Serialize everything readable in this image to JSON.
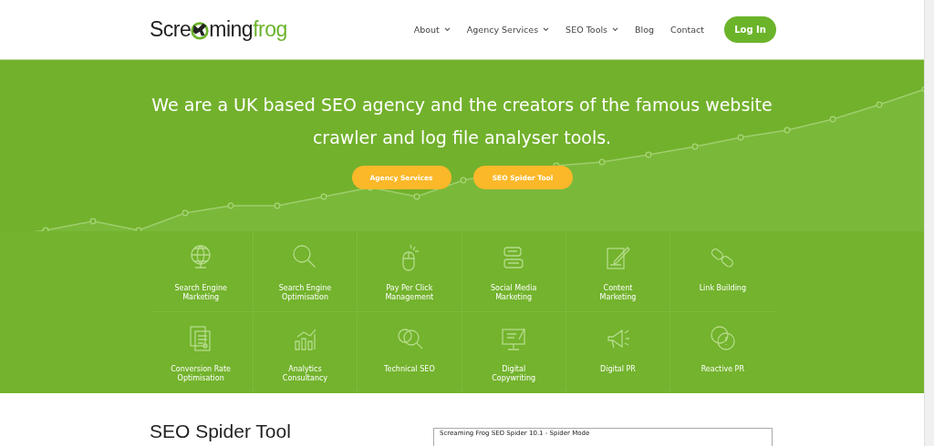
{
  "logo": {
    "part_1": "Scre",
    "part_2": "ming",
    "part_3": "frog"
  },
  "nav": [
    {
      "label": "About",
      "dropdown": true
    },
    {
      "label": "Agency Services",
      "dropdown": true
    },
    {
      "label": "SEO Tools",
      "dropdown": true
    },
    {
      "label": "Blog",
      "dropdown": false
    },
    {
      "label": "Contact",
      "dropdown": false
    }
  ],
  "login_button": "Log In",
  "hero": {
    "headline": "We are a UK based SEO agency and the creators of the famous website crawler and log file analyser tools.",
    "buttons": [
      "Agency Services",
      "SEO Spider Tool"
    ]
  },
  "services": [
    {
      "label": "Search Engine Marketing"
    },
    {
      "label": "Search Engine Optimisation"
    },
    {
      "label": "Pay Per Click Management"
    },
    {
      "label": "Social Media Marketing"
    },
    {
      "label": "Content Marketing"
    },
    {
      "label": "Link Building"
    },
    {
      "label": "Conversion Rate Optimisation"
    },
    {
      "label": "Analytics Consultancy"
    },
    {
      "label": "Technical SEO"
    },
    {
      "label": "Digital Copywriting"
    },
    {
      "label": "Digital PR"
    },
    {
      "label": "Reactive PR"
    }
  ],
  "section": {
    "heading": "SEO Spider Tool",
    "screenshot_title": "Screaming Frog SEO Spider 10.1 - Spider Mode"
  }
}
